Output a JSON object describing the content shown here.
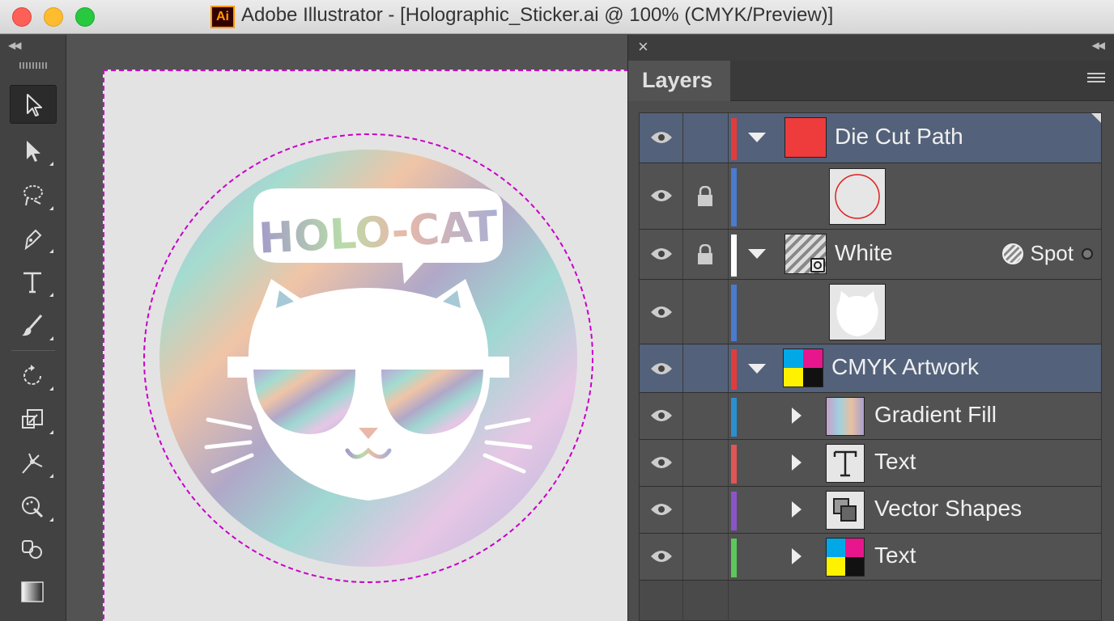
{
  "window": {
    "title": "Adobe Illustrator - [Holographic_Sticker.ai @ 100% (CMYK/Preview)]",
    "app_icon_label": "Ai"
  },
  "toolbar": {
    "tools": [
      {
        "name": "selection-tool",
        "icon": "arrow-cursor-icon",
        "active": true
      },
      {
        "name": "direct-selection-tool",
        "icon": "direct-select-icon"
      },
      {
        "name": "lasso-tool",
        "icon": "lasso-icon"
      },
      {
        "name": "pen-tool",
        "icon": "pen-nib-icon"
      },
      {
        "name": "type-tool",
        "icon": "type-icon"
      },
      {
        "name": "paintbrush-tool",
        "icon": "brush-icon"
      },
      {
        "name": "rotate-tool",
        "icon": "rotate-icon"
      },
      {
        "name": "scale-tool",
        "icon": "scale-icon"
      },
      {
        "name": "puppet-warp-tool",
        "icon": "puppet-warp-icon"
      },
      {
        "name": "shape-builder-tool",
        "icon": "shape-builder-icon"
      },
      {
        "name": "blend-tool",
        "icon": "blend-icon"
      },
      {
        "name": "gradient-tool",
        "icon": "gradient-icon"
      }
    ]
  },
  "artwork": {
    "speech_text": "HOLO-CAT",
    "die_cut_color": "#c800c8"
  },
  "layers_panel": {
    "tab_label": "Layers",
    "rows": [
      {
        "label": "Die Cut Path",
        "color": "#e03c3c",
        "highlighted": true,
        "locked": false,
        "expand": "down"
      },
      {
        "label": "",
        "color": "#4a7bd0",
        "highlighted": false,
        "locked": true,
        "expand": "none"
      },
      {
        "label": "White",
        "color": "#ffffff",
        "highlighted": false,
        "locked": true,
        "expand": "down",
        "badge": "Spot"
      },
      {
        "label": "",
        "color": "#4a7bd0",
        "highlighted": false,
        "locked": false,
        "expand": "none"
      },
      {
        "label": "CMYK Artwork",
        "color": "#e03c3c",
        "highlighted": true,
        "locked": false,
        "expand": "down"
      },
      {
        "label": "Gradient Fill",
        "color": "#2a8fd0",
        "highlighted": false,
        "locked": false,
        "expand": "right"
      },
      {
        "label": "Text",
        "color": "#e05555",
        "highlighted": false,
        "locked": false,
        "expand": "right"
      },
      {
        "label": "Vector Shapes",
        "color": "#8a55c8",
        "highlighted": false,
        "locked": false,
        "expand": "right"
      },
      {
        "label": "Text",
        "color": "#5cc85c",
        "highlighted": false,
        "locked": false,
        "expand": "right"
      }
    ]
  }
}
